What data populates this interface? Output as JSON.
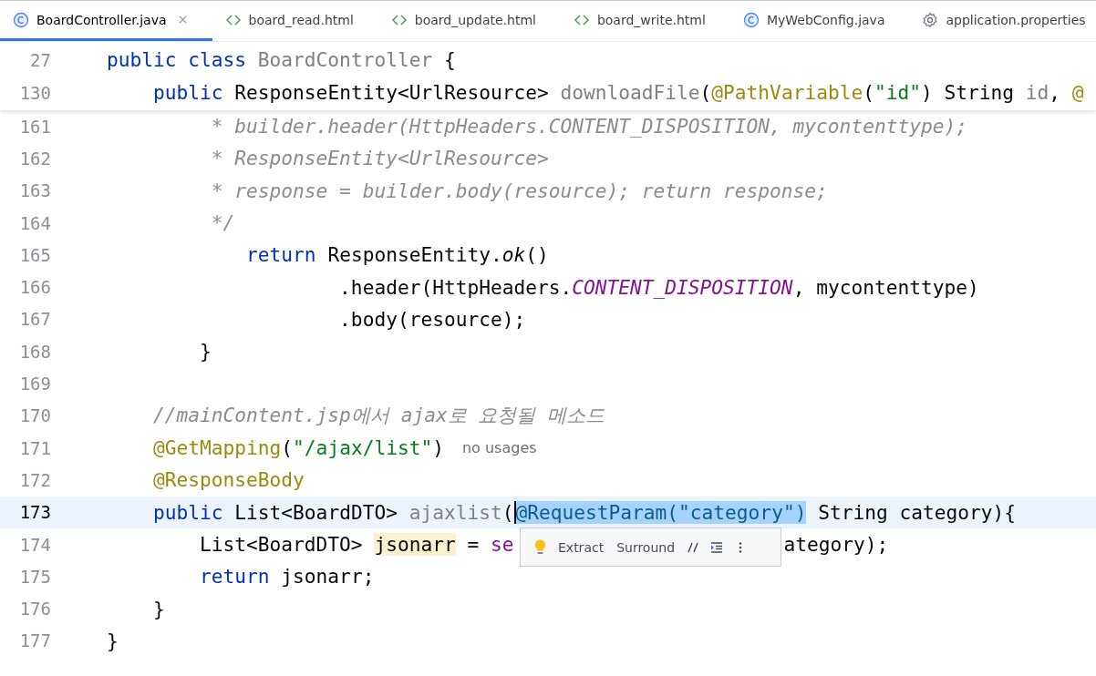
{
  "tabs": [
    {
      "label": "BoardController.java",
      "kind": "class",
      "selected": true,
      "closable": true
    },
    {
      "label": "board_read.html",
      "kind": "html",
      "selected": false,
      "closable": false
    },
    {
      "label": "board_update.html",
      "kind": "html",
      "selected": false,
      "closable": false
    },
    {
      "label": "board_write.html",
      "kind": "html",
      "selected": false,
      "closable": false
    },
    {
      "label": "MyWebConfig.java",
      "kind": "class",
      "selected": false,
      "closable": false
    },
    {
      "label": "application.properties",
      "kind": "settings",
      "selected": false,
      "closable": false
    }
  ],
  "sticky_lines": [
    {
      "number": "27",
      "tokens": [
        {
          "t": "public class ",
          "kind": "keyword"
        },
        {
          "t": "BoardController",
          "kind": "muted"
        },
        {
          "t": " {",
          "kind": "plain"
        }
      ]
    },
    {
      "number": "130",
      "tokens": [
        {
          "t": "    public ",
          "kind": "keyword"
        },
        {
          "t": "ResponseEntity<UrlResource> ",
          "kind": "plain"
        },
        {
          "t": "downloadFile",
          "kind": "muted"
        },
        {
          "t": "(",
          "kind": "plain"
        },
        {
          "t": "@PathVariable",
          "kind": "annotation"
        },
        {
          "t": "(",
          "kind": "plain"
        },
        {
          "t": "\"id\"",
          "kind": "string"
        },
        {
          "t": ") String ",
          "kind": "plain"
        },
        {
          "t": "id",
          "kind": "muted"
        },
        {
          "t": ", ",
          "kind": "plain"
        },
        {
          "t": "@",
          "kind": "annotation"
        }
      ]
    }
  ],
  "lines": [
    {
      "number": "161",
      "current": false,
      "tokens": [
        {
          "t": "         * builder.header(HttpHeaders.CONTENT_DISPOSITION, mycontenttype);",
          "kind": "comment"
        }
      ]
    },
    {
      "number": "162",
      "current": false,
      "tokens": [
        {
          "t": "         * ResponseEntity<UrlResource>",
          "kind": "comment"
        }
      ]
    },
    {
      "number": "163",
      "current": false,
      "tokens": [
        {
          "t": "         * response = builder.body(resource); return response;",
          "kind": "comment"
        }
      ]
    },
    {
      "number": "164",
      "current": false,
      "tokens": [
        {
          "t": "         */",
          "kind": "comment"
        }
      ]
    },
    {
      "number": "165",
      "current": false,
      "tokens": [
        {
          "t": "            return ",
          "kind": "keyword"
        },
        {
          "t": "ResponseEntity.",
          "kind": "plain"
        },
        {
          "t": "ok",
          "kind": "italic"
        },
        {
          "t": "()",
          "kind": "plain"
        }
      ]
    },
    {
      "number": "166",
      "current": false,
      "tokens": [
        {
          "t": "                    .header(HttpHeaders.",
          "kind": "plain"
        },
        {
          "t": "CONTENT_DISPOSITION",
          "kind": "constant"
        },
        {
          "t": ", mycontenttype)",
          "kind": "plain"
        }
      ]
    },
    {
      "number": "167",
      "current": false,
      "tokens": [
        {
          "t": "                    .body(resource);",
          "kind": "plain"
        }
      ]
    },
    {
      "number": "168",
      "current": false,
      "tokens": [
        {
          "t": "        }",
          "kind": "plain"
        }
      ]
    },
    {
      "number": "169",
      "current": false
    },
    {
      "number": "170",
      "current": false,
      "tokens": [
        {
          "t": "    //mainContent.jsp에서 ajax로 요청될 메소드",
          "kind": "comment"
        }
      ]
    },
    {
      "number": "171",
      "current": false,
      "tokens": [
        {
          "t": "    @GetMapping",
          "kind": "annotation"
        },
        {
          "t": "(",
          "kind": "plain"
        },
        {
          "t": "\"/ajax/list\"",
          "kind": "string"
        },
        {
          "t": ")",
          "kind": "plain"
        },
        {
          "t": "no usages",
          "kind": "hint"
        }
      ]
    },
    {
      "number": "172",
      "current": false,
      "tokens": [
        {
          "t": "    @ResponseBody",
          "kind": "annotation"
        }
      ]
    },
    {
      "number": "173",
      "current": true,
      "tokens": [
        {
          "t": "    public ",
          "kind": "keyword"
        },
        {
          "t": "List<BoardDTO> ",
          "kind": "plain"
        },
        {
          "t": "ajaxlist",
          "kind": "muted"
        },
        {
          "t": "(",
          "kind": "plain"
        },
        {
          "t": "@RequestParam(\"category\")",
          "kind": "selection"
        },
        {
          "t": " String category){",
          "kind": "plain"
        }
      ]
    },
    {
      "number": "174",
      "current": false,
      "tokens": [
        {
          "t": "        List<BoardDTO> ",
          "kind": "plain"
        },
        {
          "t": "jsonarr",
          "kind": "usage"
        },
        {
          "t": " = ",
          "kind": "plain"
        },
        {
          "t": "se",
          "kind": "field"
        },
        {
          "t": "ategory);",
          "kind": "resumed"
        }
      ]
    },
    {
      "number": "175",
      "current": false,
      "tokens": [
        {
          "t": "        return ",
          "kind": "keyword"
        },
        {
          "t": "jsonarr;",
          "kind": "plain"
        }
      ]
    },
    {
      "number": "176",
      "current": false,
      "tokens": [
        {
          "t": "    }",
          "kind": "plain"
        }
      ]
    },
    {
      "number": "177",
      "current": false,
      "tokens": [
        {
          "t": "}",
          "kind": "plain"
        }
      ]
    }
  ],
  "intention_popup": {
    "actions": [
      {
        "label": "Extract",
        "kind": "text"
      },
      {
        "label": "Surround",
        "kind": "text"
      },
      {
        "kind": "comment"
      },
      {
        "kind": "indent"
      },
      {
        "kind": "more"
      }
    ]
  }
}
